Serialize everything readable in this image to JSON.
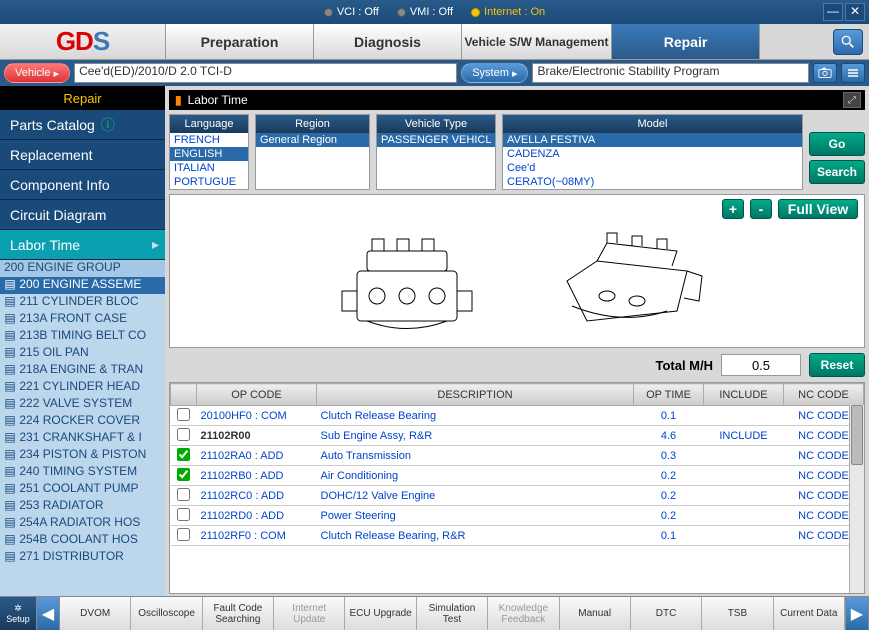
{
  "titlebar": {
    "vci": "VCI : Off",
    "vmi": "VMI : Off",
    "internet": "Internet : On"
  },
  "logo": {
    "g": "G",
    "d": "D",
    "s": "S"
  },
  "tabs": {
    "preparation": "Preparation",
    "diagnosis": "Diagnosis",
    "sw": "Vehicle S/W Management",
    "repair": "Repair"
  },
  "selbar": {
    "vehicle_label": "Vehicle",
    "vehicle_value": "Cee'd(ED)/2010/D 2.0 TCI-D",
    "system_label": "System",
    "system_value": "Brake/Electronic Stability Program"
  },
  "leftnav": {
    "title": "Repair",
    "items": [
      {
        "label": "Parts Catalog",
        "info": true
      },
      {
        "label": "Replacement"
      },
      {
        "label": "Component Info"
      },
      {
        "label": "Circuit Diagram"
      },
      {
        "label": "Labor Time",
        "active": true
      }
    ],
    "tree_header": "200 ENGINE GROUP",
    "tree": [
      {
        "l": "200 ENGINE ASSEME",
        "sel": true
      },
      {
        "l": "211 CYLINDER BLOC"
      },
      {
        "l": "213A FRONT CASE"
      },
      {
        "l": "213B TIMING BELT CO"
      },
      {
        "l": "215 OIL PAN"
      },
      {
        "l": "218A ENGINE & TRAN"
      },
      {
        "l": "221 CYLINDER HEAD"
      },
      {
        "l": "222 VALVE SYSTEM"
      },
      {
        "l": "224 ROCKER COVER"
      },
      {
        "l": "231 CRANKSHAFT & I"
      },
      {
        "l": "234 PISTON & PISTON"
      },
      {
        "l": "240 TIMING SYSTEM"
      },
      {
        "l": "251 COOLANT PUMP"
      },
      {
        "l": "253 RADIATOR"
      },
      {
        "l": "254A RADIATOR HOS"
      },
      {
        "l": "254B COOLANT HOS"
      },
      {
        "l": "271 DISTRIBUTOR"
      }
    ]
  },
  "crumb": "Labor Time",
  "filters": {
    "language": {
      "label": "Language",
      "opts": [
        "FRENCH",
        "ENGLISH",
        "ITALIAN",
        "PORTUGUE"
      ],
      "sel": "ENGLISH"
    },
    "region": {
      "label": "Region",
      "opts": [
        "General Region"
      ]
    },
    "vtype": {
      "label": "Vehicle Type",
      "opts": [
        "PASSENGER VEHICL"
      ]
    },
    "model": {
      "label": "Model",
      "opts": [
        "AVELLA FESTIVA",
        "CADENZA",
        "Cee'd",
        "CERATO(~08MY)"
      ],
      "sel": "AVELLA FESTIVA"
    },
    "go": "Go",
    "search": "Search"
  },
  "imgtools": {
    "plus": "+",
    "minus": "-",
    "fullview": "Full View"
  },
  "total": {
    "label": "Total M/H",
    "value": "0.5",
    "reset": "Reset"
  },
  "grid": {
    "headers": {
      "chk": "",
      "op": "OP CODE",
      "desc": "DESCRIPTION",
      "time": "OP TIME",
      "inc": "INCLUDE",
      "nc": "NC CODE"
    },
    "rows": [
      {
        "chk": false,
        "op": "20100HF0 : COM",
        "desc": "Clutch Release Bearing",
        "time": "0.1",
        "inc": "",
        "nc": "NC CODE"
      },
      {
        "chk": false,
        "op": "21102R00",
        "bold": true,
        "desc": "Sub Engine Assy, R&R",
        "time": "4.6",
        "inc": "INCLUDE",
        "nc": "NC CODE"
      },
      {
        "chk": true,
        "op": "21102RA0 : ADD",
        "desc": "Auto Transmission",
        "time": "0.3",
        "inc": "",
        "nc": "NC CODE"
      },
      {
        "chk": true,
        "op": "21102RB0 : ADD",
        "desc": "Air Conditioning",
        "time": "0.2",
        "inc": "",
        "nc": "NC CODE"
      },
      {
        "chk": false,
        "op": "21102RC0 : ADD",
        "desc": "DOHC/12 Valve Engine",
        "time": "0.2",
        "inc": "",
        "nc": "NC CODE"
      },
      {
        "chk": false,
        "op": "21102RD0 : ADD",
        "desc": "Power Steering",
        "time": "0.2",
        "inc": "",
        "nc": "NC CODE"
      },
      {
        "chk": false,
        "op": "21102RF0 : COM",
        "desc": "Clutch Release Bearing, R&R",
        "time": "0.1",
        "inc": "",
        "nc": "NC CODE"
      }
    ]
  },
  "bottombar": {
    "setup": "Setup",
    "btns": [
      "DVOM",
      "Oscilloscope",
      "Fault Code Searching",
      "Internet Update",
      "ECU Upgrade",
      "Simulation Test",
      "Knowledge Feedback",
      "Manual",
      "DTC",
      "TSB",
      "Current Data"
    ]
  }
}
